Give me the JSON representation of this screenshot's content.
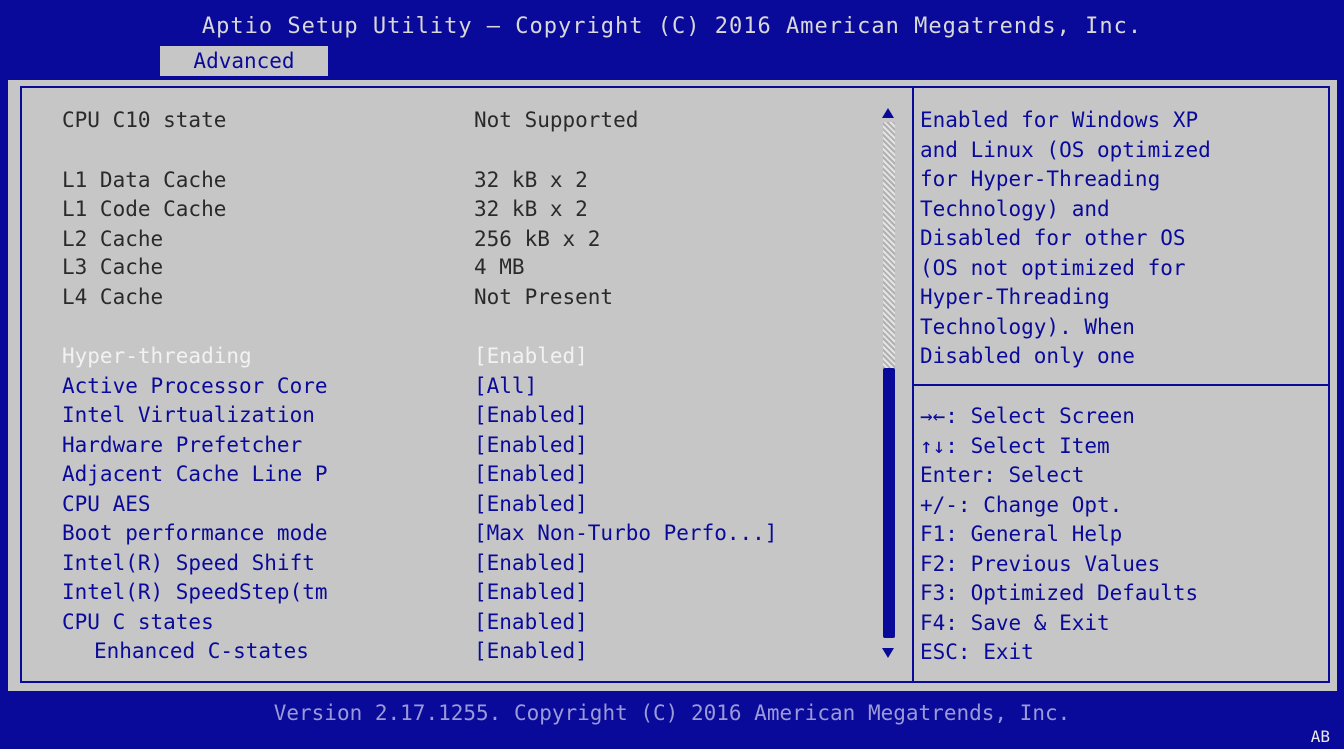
{
  "header": {
    "title": "Aptio Setup Utility – Copyright (C) 2016 American Megatrends, Inc.",
    "tab": "Advanced"
  },
  "info_rows": [
    {
      "label": "CPU C10 state",
      "value": "Not Supported"
    },
    {
      "label": "L1 Data Cache",
      "value": "32 kB x 2"
    },
    {
      "label": "L1 Code Cache",
      "value": "32 kB x 2"
    },
    {
      "label": "L2 Cache",
      "value": "256 kB x 2"
    },
    {
      "label": "L3 Cache",
      "value": "4 MB"
    },
    {
      "label": "L4 Cache",
      "value": "Not Present"
    }
  ],
  "settings": [
    {
      "label": "Hyper-threading",
      "value": "[Enabled]"
    },
    {
      "label": "Active Processor Core",
      "value": "[All]"
    },
    {
      "label": "Intel Virtualization",
      "value": "[Enabled]"
    },
    {
      "label": "Hardware Prefetcher",
      "value": "[Enabled]"
    },
    {
      "label": "Adjacent Cache Line P",
      "value": "[Enabled]"
    },
    {
      "label": "CPU AES",
      "value": "[Enabled]"
    },
    {
      "label": "Boot performance mode",
      "value": "[Max Non-Turbo Perfo...]"
    },
    {
      "label": "Intel(R) Speed Shift",
      "value": "[Enabled]"
    },
    {
      "label": "Intel(R) SpeedStep(tm",
      "value": "[Enabled]"
    },
    {
      "label": "CPU C states",
      "value": "[Enabled]"
    },
    {
      "label": "Enhanced C-states",
      "value": "[Enabled]"
    }
  ],
  "help": [
    "Enabled for Windows XP",
    "and Linux (OS optimized",
    "for Hyper-Threading",
    "Technology) and",
    "Disabled for other OS",
    "(OS not optimized for",
    "Hyper-Threading",
    "Technology). When",
    "Disabled only one"
  ],
  "keys": [
    "→←: Select Screen",
    "↑↓: Select Item",
    "Enter: Select",
    "+/-: Change Opt.",
    "F1: General Help",
    "F2: Previous Values",
    "F3: Optimized Defaults",
    "F4: Save & Exit",
    "ESC: Exit"
  ],
  "footer": {
    "version": "Version 2.17.1255. Copyright (C) 2016 American Megatrends, Inc.",
    "corner": "AB"
  },
  "colors": {
    "bios_blue": "#0a0a9a",
    "panel_gray": "#c6c6c6",
    "selected_text": "#f2f2f2"
  }
}
